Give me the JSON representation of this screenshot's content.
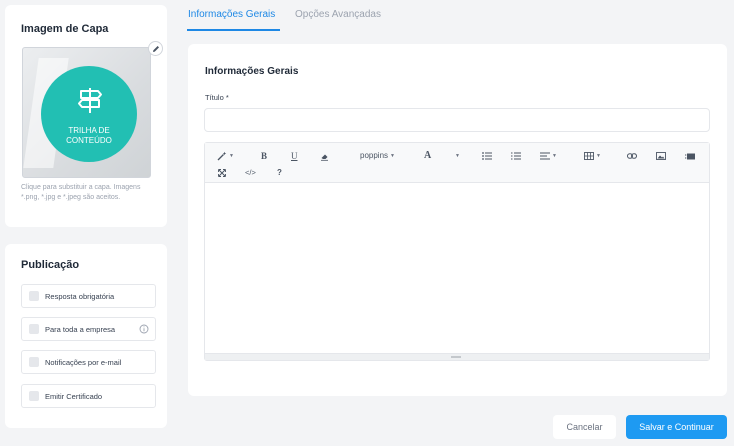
{
  "cover": {
    "title": "Imagem de Capa",
    "image_label": "TRILHA DE\nCONTEÚDO",
    "hint": "Clique para substituir a capa. Imagens *.png, *.jpg e *.jpeg são aceitos.",
    "accent_color": "#22bfb3"
  },
  "publication": {
    "title": "Publicação",
    "options": [
      {
        "label": "Resposta obrigatória",
        "checked": false
      },
      {
        "label": "Para toda a empresa",
        "checked": false,
        "has_info": true
      },
      {
        "label": "Notificações por e-mail",
        "checked": false
      },
      {
        "label": "Emitir Certificado",
        "checked": false
      }
    ]
  },
  "tabs": [
    {
      "label": "Informações Gerais",
      "active": true
    },
    {
      "label": "Opções Avançadas",
      "active": false
    }
  ],
  "form": {
    "section_title": "Informações Gerais",
    "title_label": "Título *",
    "title_value": "",
    "title_placeholder": ""
  },
  "editor": {
    "font_name": "poppins",
    "body": "",
    "toolbar_icons": [
      "magic-wand-icon",
      "bold-icon",
      "underline-icon",
      "eraser-icon",
      "font-family-select",
      "font-color-icon",
      "color-caret-icon",
      "unordered-list-icon",
      "ordered-list-icon",
      "paragraph-align-icon",
      "table-icon",
      "link-icon",
      "picture-icon",
      "video-icon",
      "fullscreen-icon",
      "code-view-icon",
      "help-icon"
    ],
    "help_label": "?",
    "code_label": "</>"
  },
  "actions": {
    "cancel_label": "Cancelar",
    "save_label": "Salvar e Continuar",
    "primary_color": "#1e9af2"
  }
}
